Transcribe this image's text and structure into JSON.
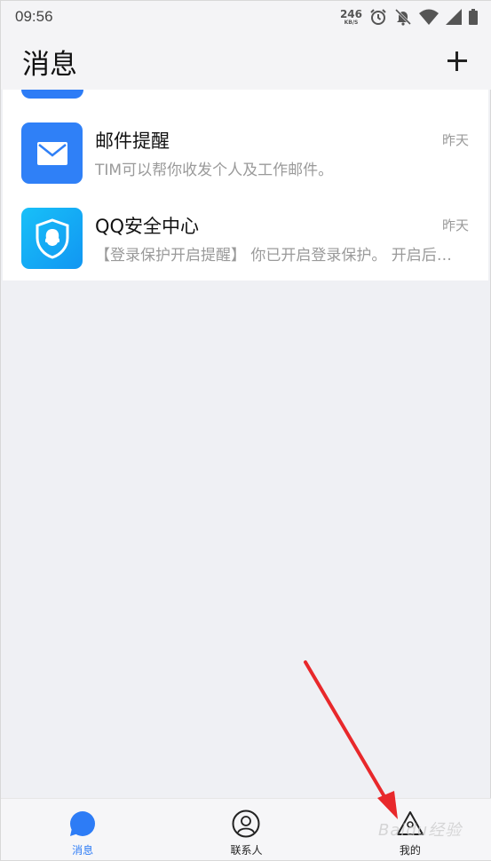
{
  "status_bar": {
    "time": "09:56",
    "net_speed": "246",
    "net_unit": "KB/S"
  },
  "header": {
    "title": "消息"
  },
  "messages": [
    {
      "name": "邮件提醒",
      "time": "昨天",
      "preview": "TIM可以帮你收发个人及工作邮件。",
      "icon": "mail-icon"
    },
    {
      "name": "QQ安全中心",
      "time": "昨天",
      "preview": "【登录保护开启提醒】 你已开启登录保护。 开启后，你的帐号将更安全",
      "icon": "shield-icon"
    }
  ],
  "bottom_nav": [
    {
      "label": "消息",
      "icon": "chat-bubble-icon",
      "active": true
    },
    {
      "label": "联系人",
      "icon": "contact-icon",
      "active": false
    },
    {
      "label": "我的",
      "icon": "triangle-icon",
      "active": false
    }
  ],
  "colors": {
    "accent": "#2d7cf6",
    "annotation": "#e8282b"
  },
  "watermark": "Baidu经验"
}
